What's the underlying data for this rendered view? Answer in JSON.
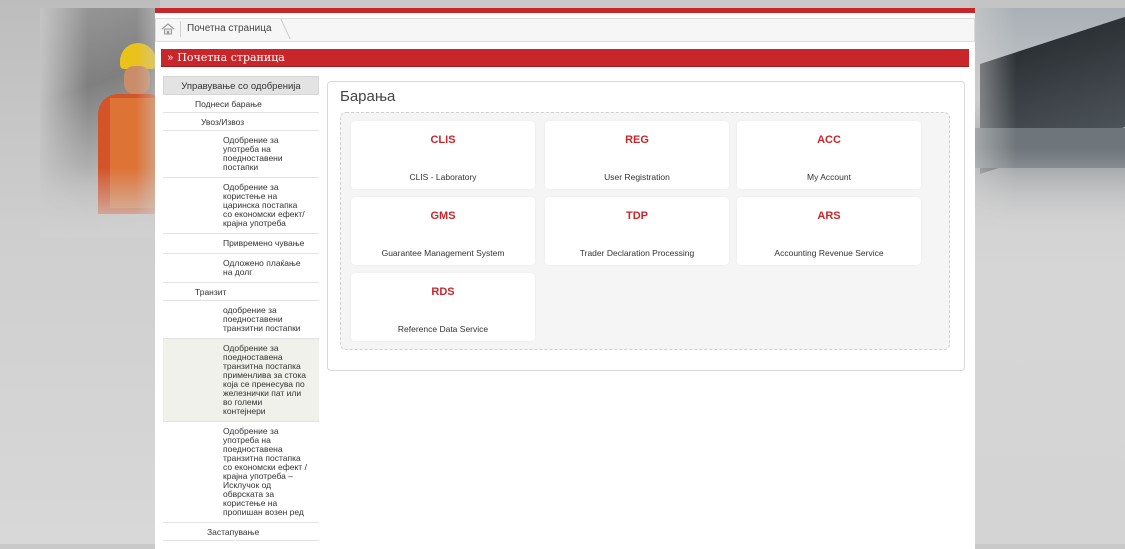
{
  "breadcrumb": {
    "home_icon": "home-icon",
    "current": "Почетна страница"
  },
  "title_bar": "» Почетна страница",
  "sidebar": {
    "items": [
      {
        "label": "Управување со одобренија",
        "level": 0
      },
      {
        "label": "Поднеси барање",
        "level": 1
      },
      {
        "label": "Увоз/Извоз",
        "level": 1
      },
      {
        "label": "Одобрение за употреба на поедноставени постапки",
        "level": 2
      },
      {
        "label": "Одобрение за користење на царинска постапка со економски ефект/крајна употреба",
        "level": 2
      },
      {
        "label": "Привремено чување",
        "level": 2
      },
      {
        "label": "Одложено плаќање на долг",
        "level": 2
      },
      {
        "label": "Транзит",
        "level": 1
      },
      {
        "label": "одобрение за поедноставени транзитни постапки",
        "level": 2
      },
      {
        "label": "Одобрение за поедноставена транзитна постапка применлива за стока која се пренесува по железнички пат или во големи контејнери",
        "level": 2
      },
      {
        "label": "Одобрение за употреба на поедноставена транзитна постапка со економски ефект / крајна употреба – Исклучок од обврската за користење на пропишан возен ред",
        "level": 2
      },
      {
        "label": "Застапување",
        "level": 1
      }
    ]
  },
  "panel": {
    "title": "Барања",
    "tiles": [
      {
        "code": "CLIS",
        "label": "CLIS - Laboratory"
      },
      {
        "code": "REG",
        "label": "User Registration"
      },
      {
        "code": "ACC",
        "label": "My Account"
      },
      {
        "code": "GMS",
        "label": "Guarantee Management System"
      },
      {
        "code": "TDP",
        "label": "Trader Declaration Processing"
      },
      {
        "code": "ARS",
        "label": "Accounting Revenue Service"
      },
      {
        "code": "RDS",
        "label": "Reference Data Service"
      }
    ]
  },
  "colors": {
    "accent": "#c8262b"
  }
}
